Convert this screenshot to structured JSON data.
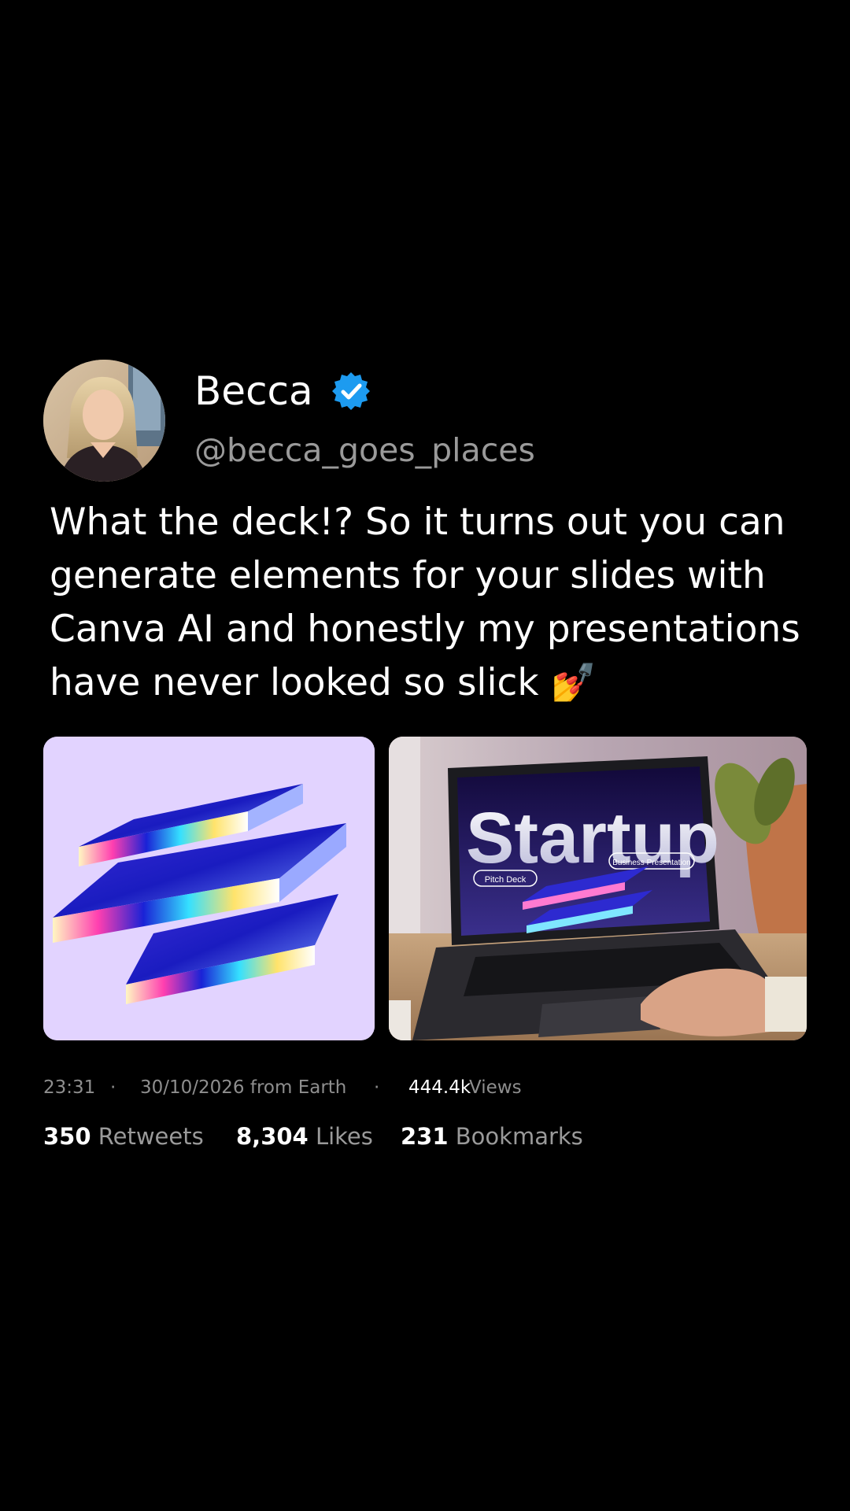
{
  "user": {
    "name": "Becca",
    "handle": "@becca_goes_places",
    "verified": true,
    "verified_color": "#1d9bf0"
  },
  "tweet": {
    "text": "What the deck!? So it turns out you can generate elements for your slides with Canva AI and honestly my presentations have never looked so slick 💅"
  },
  "media": [
    {
      "description_icon": "iridescent-stacked-shapes",
      "background": "#e2d3ff"
    },
    {
      "description_icon": "laptop-presentation",
      "slide_title": "Startup",
      "slide_tag_left": "Pitch Deck",
      "slide_tag_right": "Business Presentation"
    }
  ],
  "meta": {
    "time": "23:31",
    "separator": "·",
    "date_source": "30/10/2026 from Earth",
    "views_count": "444.4k",
    "views_label": "Views"
  },
  "stats": {
    "retweets_count": "350",
    "retweets_label": "Retweets",
    "likes_count": "8,304",
    "likes_label": "Likes",
    "bookmarks_count": "231",
    "bookmarks_label": "Bookmarks"
  },
  "colors": {
    "background": "#000000",
    "text": "#ffffff",
    "muted": "#9a9a9a"
  }
}
